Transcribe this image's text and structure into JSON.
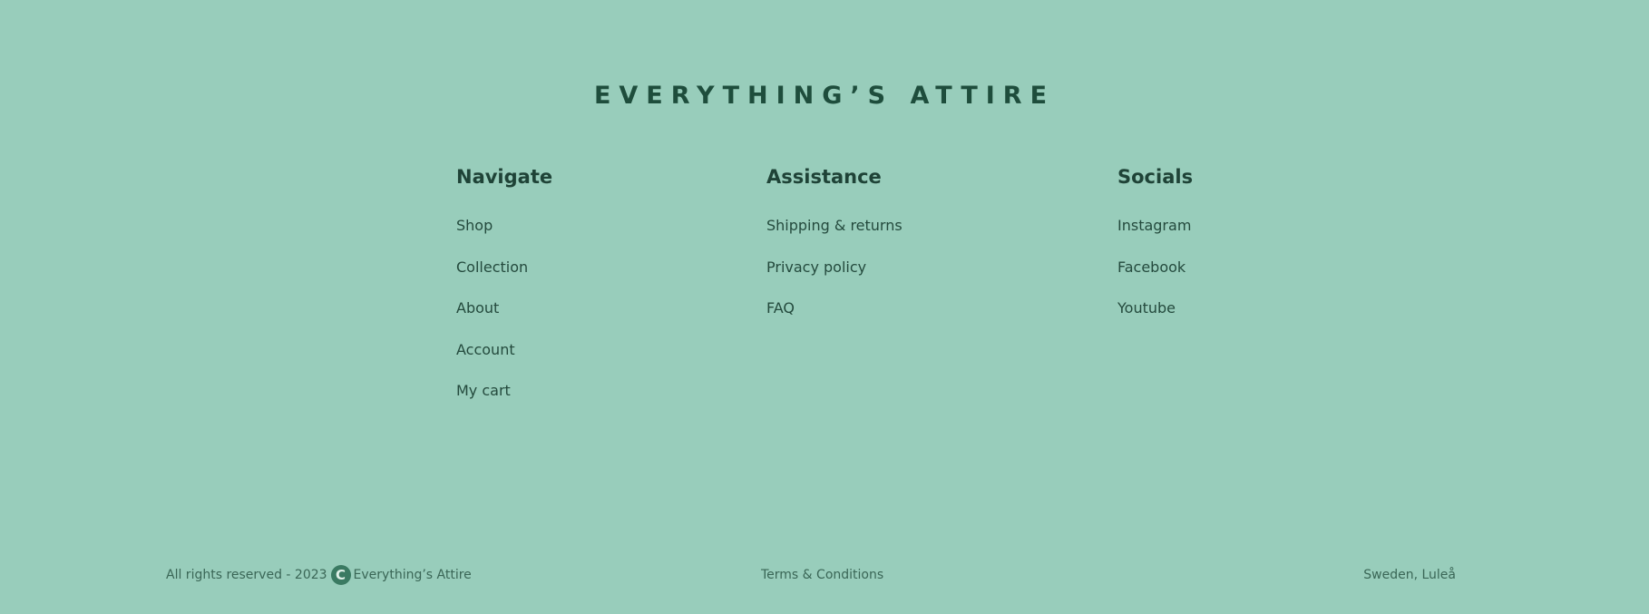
{
  "footer": {
    "brand": "EVERYTHING’S ATTIRE",
    "columns": {
      "navigate": {
        "title": "Navigate",
        "items": [
          "Shop",
          "Collection",
          "About",
          "Account",
          "My cart"
        ]
      },
      "assistance": {
        "title": "Assistance",
        "items": [
          "Shipping & returns",
          "Privacy policy",
          "FAQ"
        ]
      },
      "socials": {
        "title": "Socials",
        "items": [
          "Instagram",
          "Facebook",
          "Youtube"
        ]
      }
    },
    "bottom": {
      "rights": "All rights reserved - 2023",
      "copyright_icon": "C",
      "company": "Everything’s Attire",
      "terms": "Terms & Conditions",
      "location": "Sweden, Luleå"
    }
  },
  "colors": {
    "background": "#98cdbb",
    "text_dark": "#1f4337",
    "accent": "#3a7a62"
  }
}
